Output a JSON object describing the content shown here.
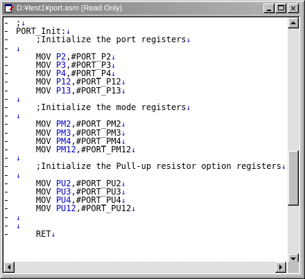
{
  "window": {
    "title": "D:¥test1¥port.asm (Read Only)",
    "title_active": false,
    "colors": {
      "register": "#0000c0",
      "eol_marker": "#0000c0",
      "text": "#000000"
    }
  },
  "title_buttons": {
    "minimize_icon": "minimize-icon",
    "maximize_icon": "maximize-icon",
    "close_icon": "close-icon",
    "close_glyph": "✕"
  },
  "editor": {
    "eol_marker": "↓",
    "lines": [
      {
        "indent": "",
        "text": ";",
        "marked": true
      },
      {
        "indent": "",
        "text": "PORT_Init:",
        "marked": true
      },
      {
        "indent": "    ",
        "text": ";Initialize the port registers",
        "marked": true
      },
      {
        "indent": "",
        "text": "",
        "marked": false
      },
      {
        "indent": "    ",
        "op": "MOV ",
        "reg": "P2",
        "rest": ",#PORT_P2",
        "marked": true
      },
      {
        "indent": "    ",
        "op": "MOV ",
        "reg": "P3",
        "rest": ",#PORT_P3",
        "marked": true
      },
      {
        "indent": "    ",
        "op": "MOV ",
        "reg": "P4",
        "rest": ",#PORT_P4",
        "marked": true
      },
      {
        "indent": "    ",
        "op": "MOV ",
        "reg": "P12",
        "rest": ",#PORT_P12",
        "marked": true
      },
      {
        "indent": "    ",
        "op": "MOV ",
        "reg": "P13",
        "rest": ",#PORT_P13",
        "marked": true
      },
      {
        "indent": "",
        "text": "",
        "marked": false
      },
      {
        "indent": "    ",
        "text": ";Initialize the mode registers",
        "marked": true
      },
      {
        "indent": "",
        "text": "",
        "marked": false
      },
      {
        "indent": "    ",
        "op": "MOV ",
        "reg": "PM2",
        "rest": ",#PORT_PM2",
        "marked": true
      },
      {
        "indent": "    ",
        "op": "MOV ",
        "reg": "PM3",
        "rest": ",#PORT_PM3",
        "marked": true
      },
      {
        "indent": "    ",
        "op": "MOV ",
        "reg": "PM4",
        "rest": ",#PORT_PM4",
        "marked": true
      },
      {
        "indent": "    ",
        "op": "MOV ",
        "reg": "PM12",
        "rest": ",#PORT_PM12",
        "marked": true
      },
      {
        "indent": "",
        "text": "",
        "marked": false
      },
      {
        "indent": "    ",
        "text": ";Initialize the Pull-up resistor option registers",
        "marked": true
      },
      {
        "indent": "",
        "text": "",
        "marked": false
      },
      {
        "indent": "    ",
        "op": "MOV ",
        "reg": "PU2",
        "rest": ",#PORT_PU2",
        "marked": true
      },
      {
        "indent": "    ",
        "op": "MOV ",
        "reg": "PU3",
        "rest": ",#PORT_PU3",
        "marked": true
      },
      {
        "indent": "    ",
        "op": "MOV ",
        "reg": "PU4",
        "rest": ",#PORT_PU4",
        "marked": true
      },
      {
        "indent": "    ",
        "op": "MOV ",
        "reg": "PU12",
        "rest": ",#PORT_PU12",
        "marked": true
      },
      {
        "indent": "",
        "text": "",
        "marked": false
      },
      {
        "indent": "",
        "text": "",
        "marked": false
      },
      {
        "indent": "    ",
        "text": "RET",
        "marked": true
      }
    ]
  },
  "scrollbars": {
    "vertical": {
      "up_icon": "scroll-up-arrow-icon",
      "down_icon": "scroll-down-arrow-icon",
      "position": 0.72
    },
    "horizontal": {
      "left_icon": "scroll-left-arrow-icon",
      "right_icon": "scroll-right-arrow-icon"
    }
  }
}
